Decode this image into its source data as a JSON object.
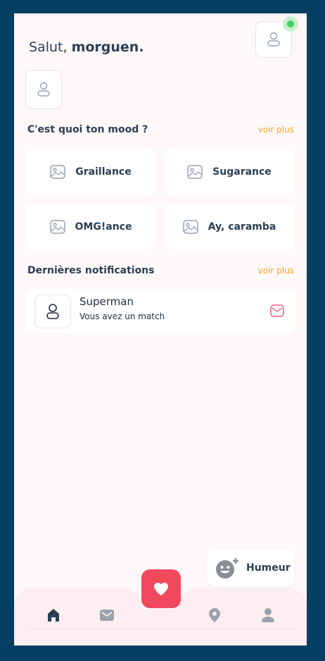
{
  "header": {
    "greeting": "Salut,",
    "username": "morguen.",
    "online_color": "#3ecf62"
  },
  "mood_section": {
    "title": "C'est quoi ton mood ?",
    "see_more": "voir plus",
    "items": [
      {
        "label": "Graillance",
        "icon": "image-icon"
      },
      {
        "label": "Sugarance",
        "icon": "image-icon"
      },
      {
        "label": "OMG!ance",
        "icon": "image-icon"
      },
      {
        "label": "Ay, caramba",
        "icon": "image-icon"
      }
    ]
  },
  "notifications_section": {
    "title": "Dernières notifications",
    "see_more": "voir plus",
    "items": [
      {
        "name": "Superman",
        "message": "Vous avez un match",
        "icon": "mail-icon"
      }
    ]
  },
  "humeur_button": {
    "label": "Humeur",
    "icon": "add-emoji-icon"
  },
  "bottom_nav": {
    "items": [
      "home-icon",
      "mail-icon",
      "location-pin-icon",
      "profile-icon"
    ],
    "fab_icon": "heart-icon",
    "accent": "#f0495d",
    "active_color": "#2b3f55",
    "inactive_color": "#9aa3ad"
  },
  "colors": {
    "frame": "#053f63",
    "background": "#fff8f9",
    "link": "#f5a623",
    "text": "#2b3f55"
  }
}
